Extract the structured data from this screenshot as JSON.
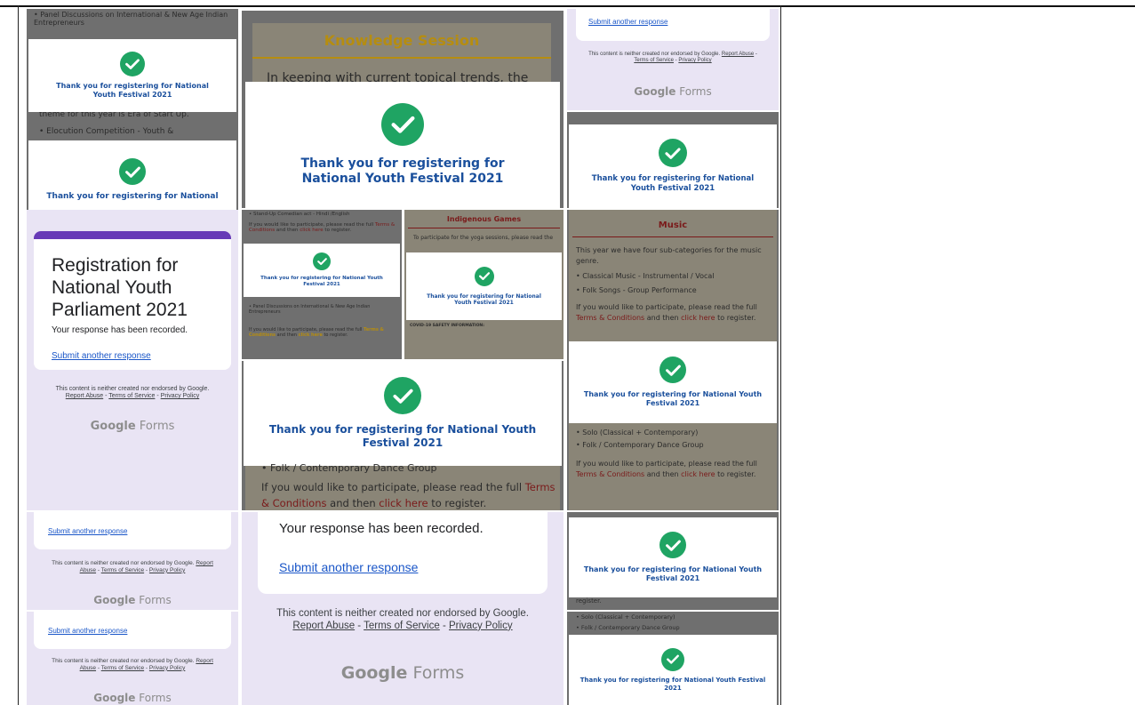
{
  "colors": {
    "check_green": "#1fa463",
    "thanks_blue": "#1a4f9c",
    "forms_purple": "#673ab7",
    "link_blue": "#1a56c8"
  },
  "icons": {
    "success": "check-circle-icon"
  },
  "thanks_text": "Thank you for registering for National Youth Festival 2021",
  "thanks_text_partial": "Thank you for registering for National",
  "background_text": {
    "panel_discussions": "• Panel Discussions on International & New Age Indian Entrepreneurs",
    "theme": "theme for this year is Era of Start Up.",
    "elocution": "• Elocution Competition - Youth &",
    "knowledge_heading": "Knowledge Session",
    "knowledge_intro": "In keeping with current topical trends, the",
    "standup": "• Stand-Up Comedian act - Hindi /English",
    "indigenous_heading": "Indigenous Games",
    "yoga": "To participate for the yoga sessions, please read the",
    "tc_prefix": "If you would like to participate, please read the full",
    "tc_terms": "Terms & Conditions",
    "tc_and_then": "and then",
    "tc_click": "click here",
    "tc_suffix": "to register.",
    "music_heading": "Music",
    "music_intro": "This year we have four sub-categories for the music genre.",
    "classical_music": "• Classical Music - Instrumental / Vocal",
    "folk_songs": "• Folk Songs - Group Performance",
    "solo": "• Solo (Classical + Contemporary)",
    "folk_dance": "• Folk / Contemporary Dance Group",
    "register_tail": "register.",
    "covid_title": "COVID-19 SAFETY INFORMATION:"
  },
  "forms": {
    "title": "Registration for National Youth Parliament 2021",
    "recorded": "Your response has been recorded.",
    "submit_another": "Submit another response",
    "disclaimer_prefix": "This content is neither created nor endorsed by Google.",
    "report_abuse": "Report Abuse",
    "terms_of_service": "Terms of Service",
    "privacy_policy": "Privacy Policy",
    "sep": " - ",
    "logo_google": "Google",
    "logo_forms": "Forms"
  }
}
